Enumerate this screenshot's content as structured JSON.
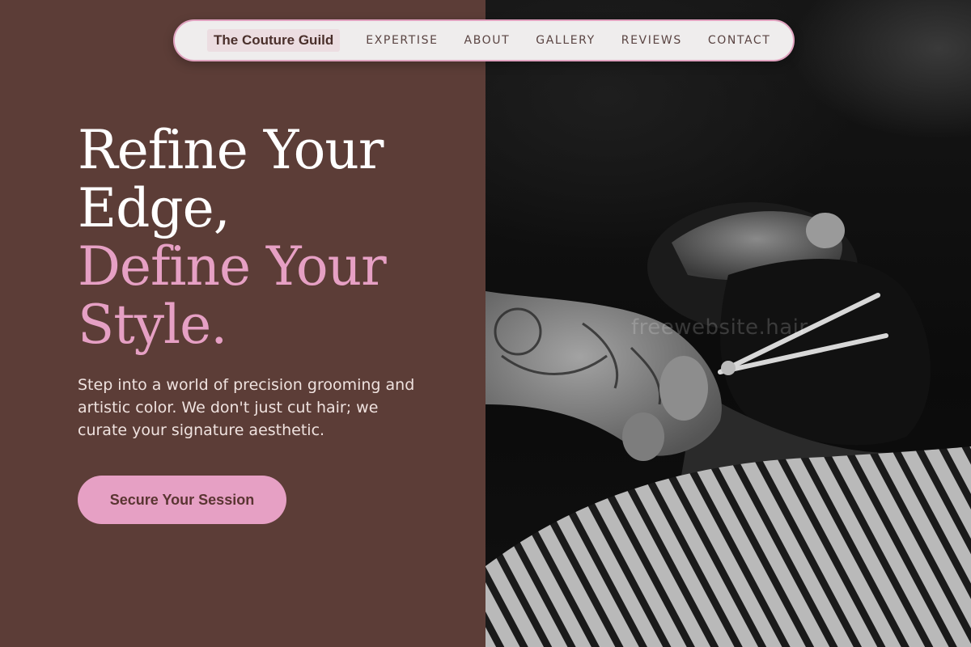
{
  "nav": {
    "brand": "The Couture Guild",
    "links": [
      {
        "label": "EXPERTISE"
      },
      {
        "label": "ABOUT"
      },
      {
        "label": "GALLERY"
      },
      {
        "label": "REVIEWS"
      },
      {
        "label": "CONTACT"
      }
    ]
  },
  "hero": {
    "headline_line1": "Refine Your",
    "headline_line2": "Edge,",
    "headline_line3": "Define Your",
    "headline_line4": "Style.",
    "subcopy": "Step into a world of precision grooming and artistic color. We don't just cut hair; we curate your signature aesthetic.",
    "cta_label": "Secure Your Session"
  },
  "photo": {
    "watermark": "freewebsite.hair"
  },
  "colors": {
    "background": "#5c3d37",
    "accent_pink": "#e6a0c4",
    "nav_bg": "#efeded",
    "nav_border": "#e0a2bf"
  }
}
